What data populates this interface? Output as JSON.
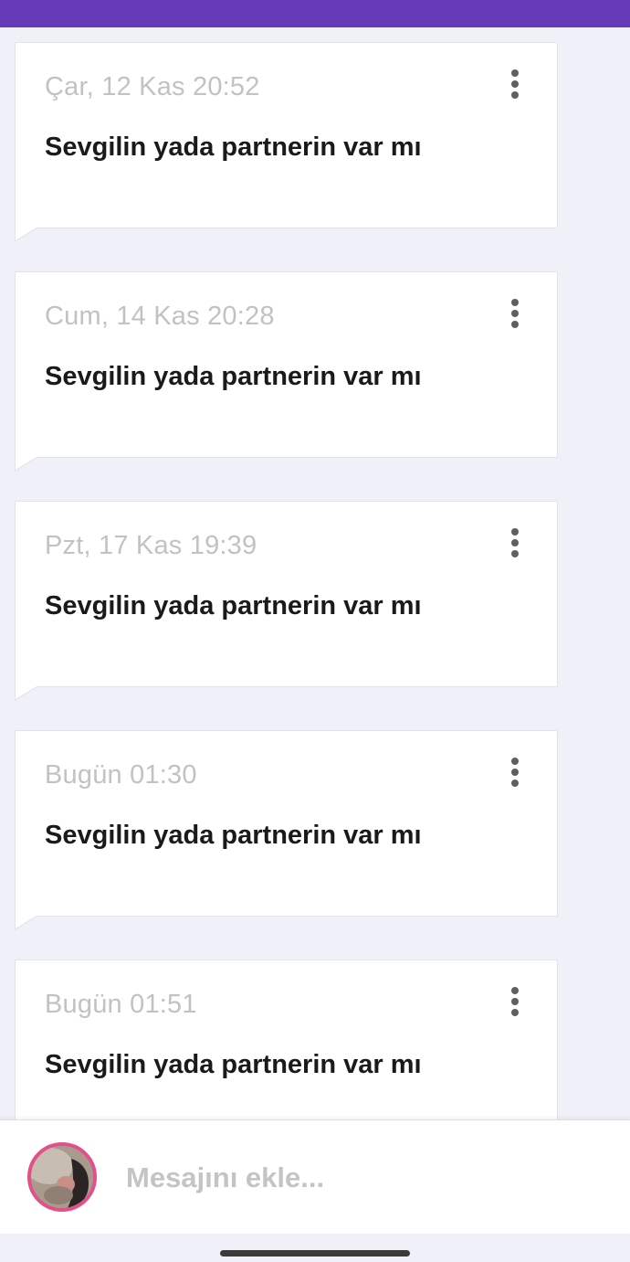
{
  "notes": [
    {
      "time": "Çar, 12 Kas 20:52",
      "text": "Sevgilin yada partnerin var mı"
    },
    {
      "time": "Cum, 14 Kas 20:28",
      "text": "Sevgilin yada partnerin var mı"
    },
    {
      "time": "Pzt, 17 Kas 19:39",
      "text": "Sevgilin yada partnerin var mı"
    },
    {
      "time": "Bugün 01:30",
      "text": "Sevgilin yada partnerin var mı"
    },
    {
      "time": "Bugün 01:51",
      "text": "Sevgilin yada partnerin var mı"
    }
  ],
  "composer": {
    "placeholder": "Mesajını ekle..."
  },
  "icons": {
    "menu": "more-vertical-icon",
    "avatar": "user-avatar"
  },
  "colors": {
    "header": "#673ab7",
    "background": "#f0f0f9",
    "avatar_ring": "#e2508a"
  }
}
